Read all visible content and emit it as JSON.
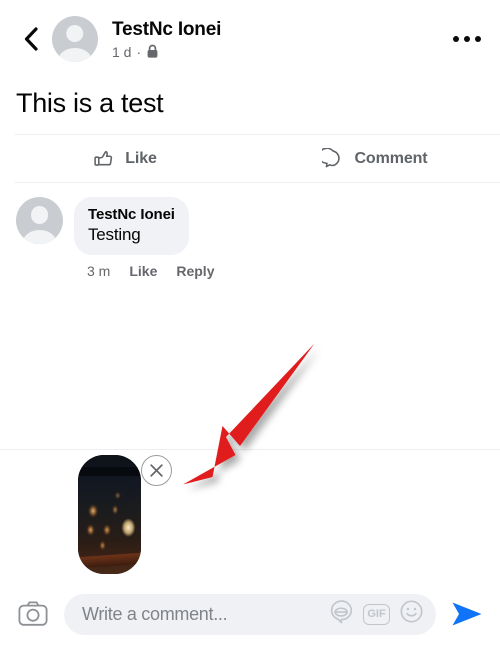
{
  "header": {
    "back_icon": "chevron-left-icon",
    "avatar_icon": "default-person-avatar",
    "author": "TestNc Ionei",
    "time": "1 d",
    "separator": "·",
    "privacy_icon": "lock-icon",
    "menu_icon": "more-options-icon"
  },
  "post": {
    "text": "This is a test"
  },
  "actions": {
    "like": {
      "label": "Like",
      "icon": "thumbs-up-icon"
    },
    "comment": {
      "label": "Comment",
      "icon": "comment-bubble-icon"
    }
  },
  "comment": {
    "avatar_icon": "default-person-avatar",
    "author": "TestNc Ionei",
    "body": "Testing",
    "time": "3 m",
    "like_label": "Like",
    "reply_label": "Reply"
  },
  "attachment": {
    "thumbnail_alt": "night-lanterns-photo",
    "remove_icon": "close-circle-icon"
  },
  "annotation": {
    "arrow_color": "#e01b1b",
    "points_to": "attachment-remove-button"
  },
  "composer": {
    "camera_icon": "camera-icon",
    "placeholder": "Write a comment...",
    "sticker_icon": "sticker-icon",
    "gif_label": "GIF",
    "gif_icon": "gif-icon",
    "emoji_icon": "emoji-smiley-icon",
    "send_icon": "send-arrow-icon",
    "send_color": "#0f74f7"
  },
  "colors": {
    "page_background": "#ffffff",
    "bubble_background": "#f0f2f5",
    "input_background": "#eff1f4",
    "secondary_text": "#65676b",
    "primary_text": "#050505",
    "divider": "#eceef0",
    "accent_blue": "#0f74f7",
    "annotation_red": "#e01b1b"
  }
}
